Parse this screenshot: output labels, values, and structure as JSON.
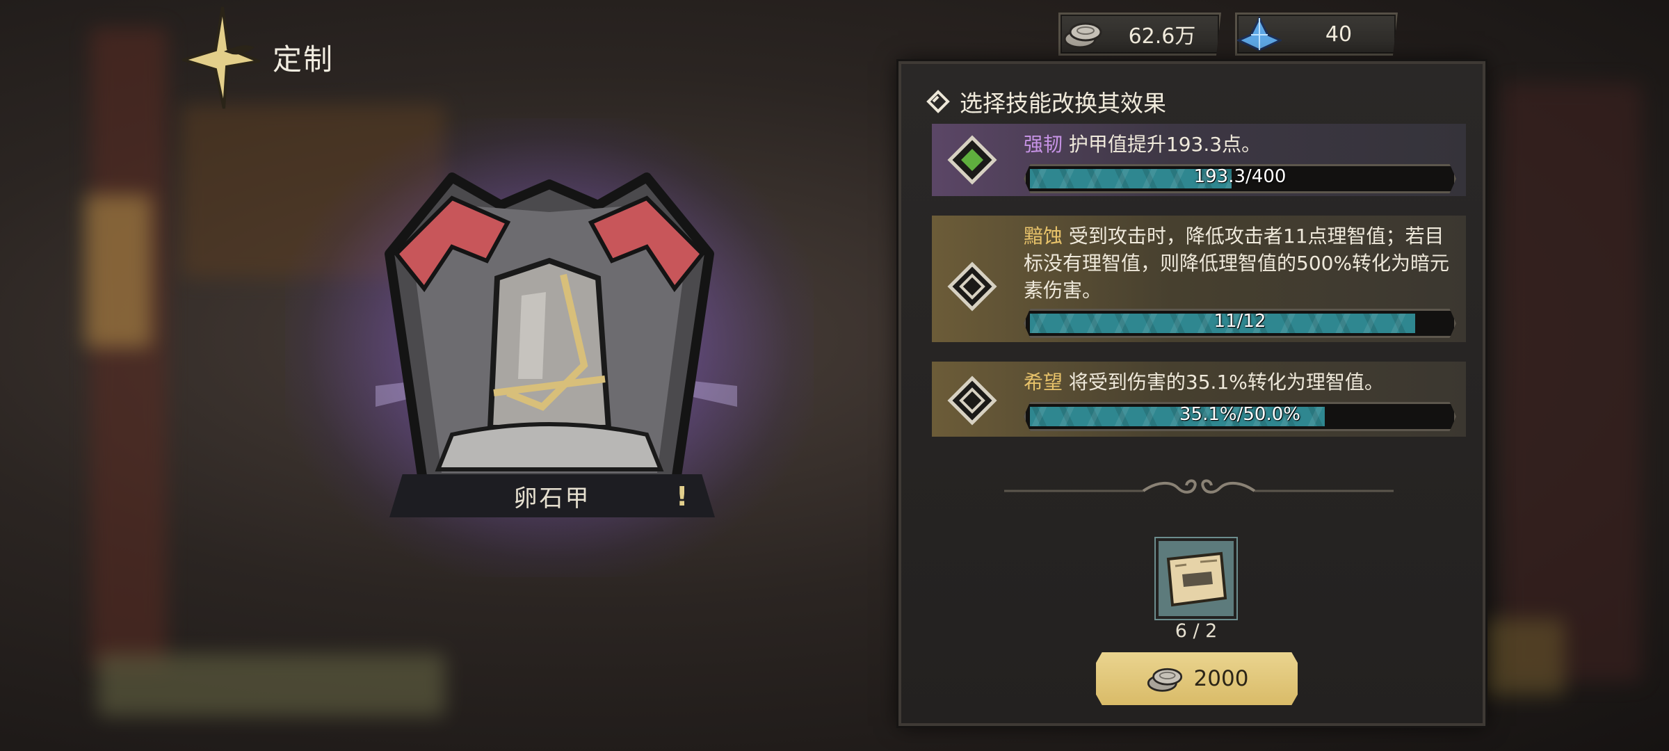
{
  "header": {
    "title": "定制",
    "back_icon": "dagger-back-icon"
  },
  "currencies": [
    {
      "icon": "silver-coins-icon",
      "value": "62.6万"
    },
    {
      "icon": "blue-crystal-icon",
      "value": "40"
    }
  ],
  "item": {
    "name": "卵石甲",
    "alert": "!",
    "icon": "pebble-armor-icon",
    "rarity_color": "#9b6fe0"
  },
  "panel": {
    "header_icon": "diamond-arrow-icon",
    "title": "选择技能改换其效果",
    "skills": [
      {
        "name": "强韧",
        "description": "护甲值提升193.3点。",
        "progress_text": "193.3/400",
        "progress": 0.48,
        "style": "purple",
        "selected": true
      },
      {
        "name": "黯蚀",
        "description": "受到攻击时，降低攻击者11点理智值；若目标没有理智值，则降低理智值的500%转化为暗元素伤害。",
        "progress_text": "11/12",
        "progress": 0.917,
        "style": "gold",
        "selected": false
      },
      {
        "name": "希望",
        "description": "将受到伤害的35.1%转化为理智值。",
        "progress_text": "35.1%/50.0%",
        "progress": 0.702,
        "style": "gold",
        "selected": false
      }
    ],
    "material": {
      "icon": "scroll-map-icon",
      "count": "6 / 2"
    },
    "customize_button": {
      "icon": "silver-coins-icon",
      "cost": "2000"
    }
  },
  "colors": {
    "accent_gold": "#e2c97e",
    "progress_teal": "#2f8790",
    "skill_purple": "#c793e6",
    "skill_gold": "#e7c26a"
  }
}
